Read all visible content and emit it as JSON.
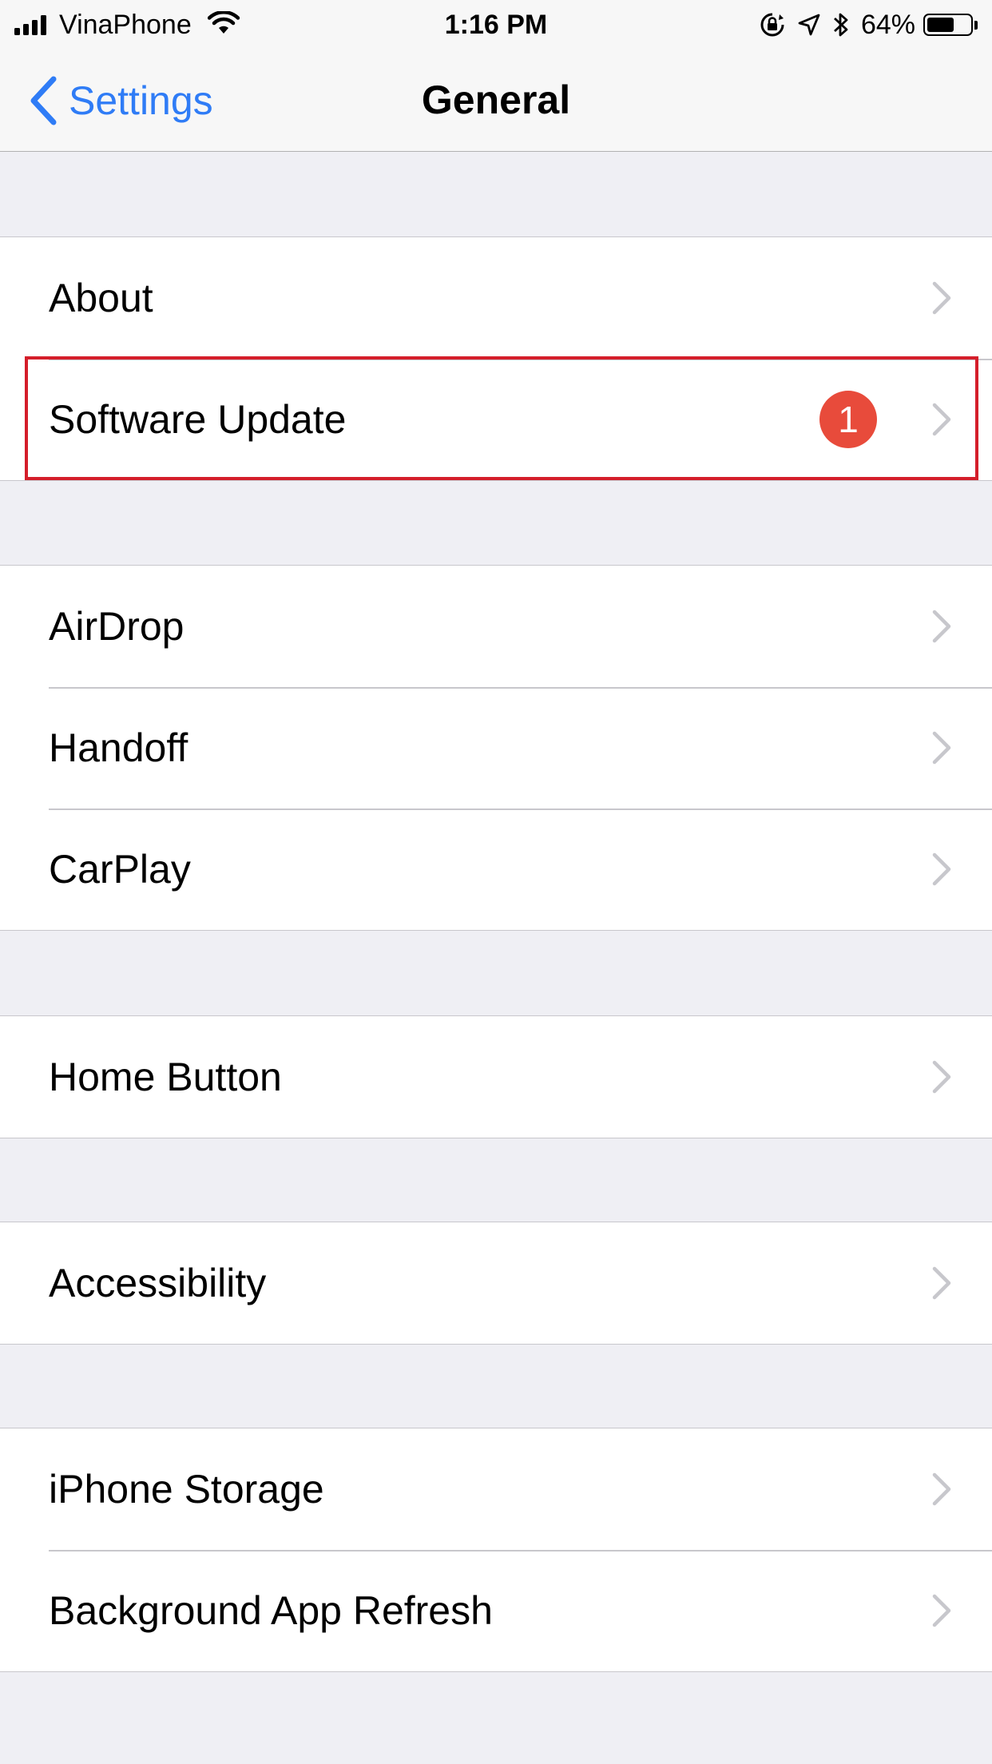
{
  "status_bar": {
    "carrier": "VinaPhone",
    "time": "1:16 PM",
    "battery_percent_label": "64%",
    "battery_level": 0.64,
    "icons": [
      "signal-bars-icon",
      "wifi-icon",
      "orientation-lock-icon",
      "location-arrow-icon",
      "bluetooth-icon",
      "battery-icon"
    ]
  },
  "nav": {
    "back_label": "Settings",
    "title": "General",
    "accent_color": "#2F7CF6"
  },
  "groups": [
    {
      "items": [
        {
          "label": "About"
        },
        {
          "label": "Software Update",
          "badge": "1",
          "highlighted": true
        }
      ]
    },
    {
      "items": [
        {
          "label": "AirDrop"
        },
        {
          "label": "Handoff"
        },
        {
          "label": "CarPlay"
        }
      ]
    },
    {
      "items": [
        {
          "label": "Home Button"
        }
      ]
    },
    {
      "items": [
        {
          "label": "Accessibility"
        }
      ]
    },
    {
      "items": [
        {
          "label": "iPhone Storage"
        },
        {
          "label": "Background App Refresh"
        }
      ]
    }
  ],
  "colors": {
    "badge": "#E84B3B",
    "highlight_border": "#D41E2A",
    "background": "#EFEFF4"
  }
}
